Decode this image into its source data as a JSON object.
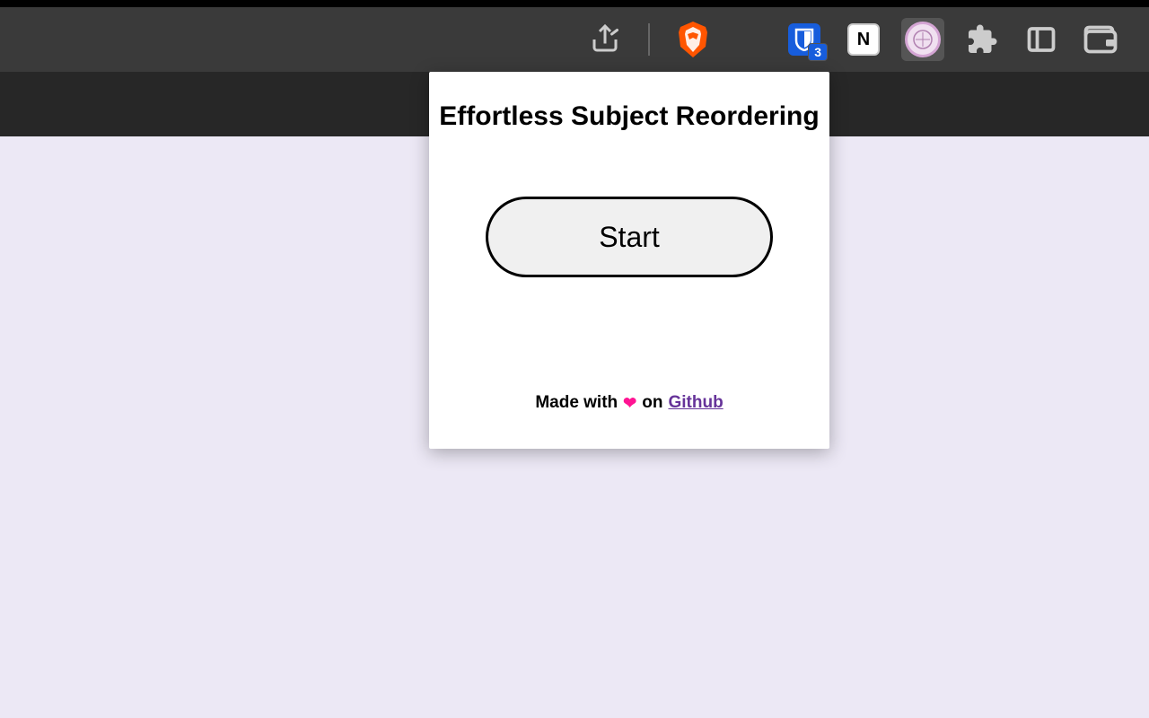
{
  "toolbar": {
    "bitwarden_badge": "3",
    "notion_letter": "N"
  },
  "popup": {
    "title": "Effortless Subject Reordering",
    "start_label": "Start",
    "footer_prefix": "Made with",
    "footer_on": "on",
    "footer_link": "Github"
  }
}
